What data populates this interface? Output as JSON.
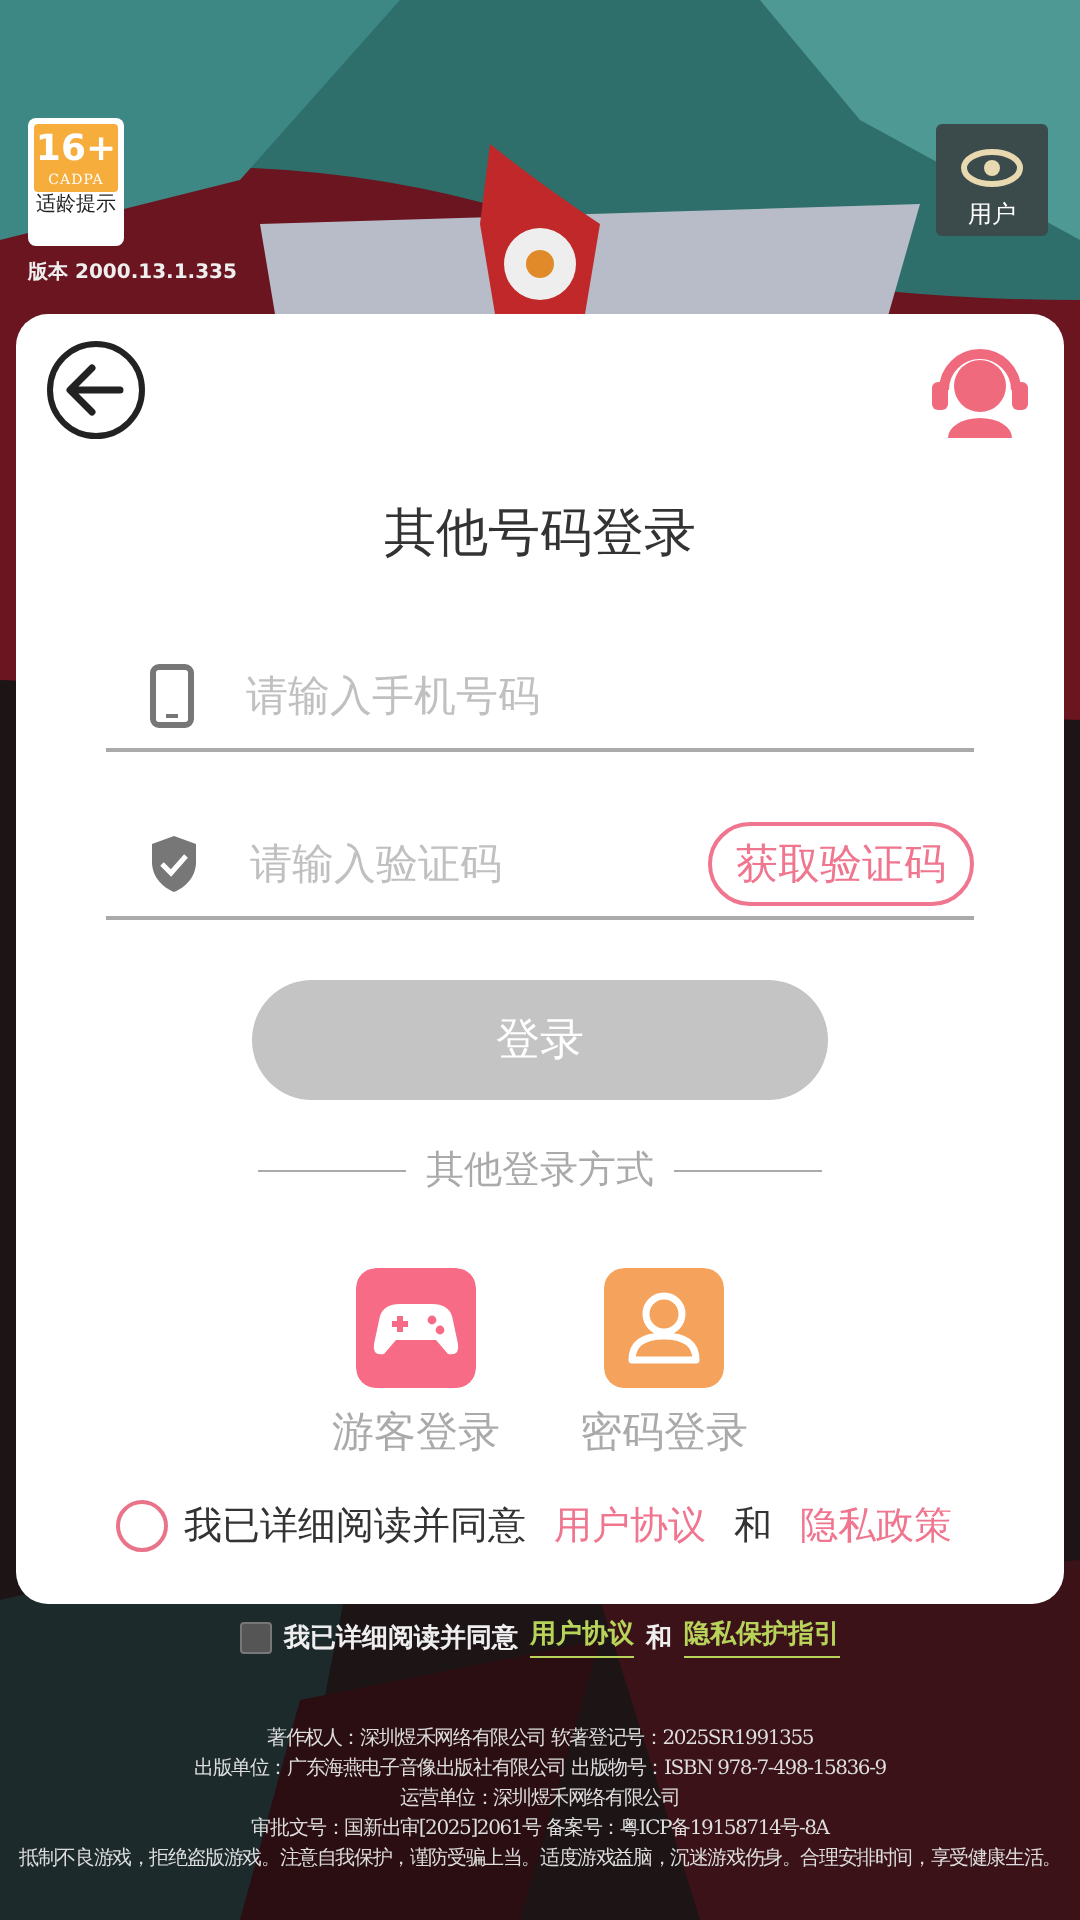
{
  "header": {
    "age_rating": {
      "age": "16+",
      "org": "CADPA",
      "caption": "适龄提示"
    },
    "version": "版本 2000.13.1.335",
    "user_button": "用户"
  },
  "login_card": {
    "title": "其他号码登录",
    "phone_field": {
      "placeholder": "请输入手机号码"
    },
    "code_field": {
      "placeholder": "请输入验证码"
    },
    "get_code_button": "获取验证码",
    "login_button": {
      "label": "登录",
      "disabled": true
    },
    "divider": "其他登录方式",
    "methods": [
      {
        "label": "游客登录",
        "kind": "guest",
        "color": "#f76b86"
      },
      {
        "label": "密码登录",
        "kind": "password",
        "color": "#f5a35c"
      }
    ],
    "agreement": {
      "checked": false,
      "text": "我已详细阅读并同意",
      "link1": "用户协议",
      "and": "和",
      "link2": "隐私政策"
    }
  },
  "outer_agreement": {
    "checked": false,
    "text": "我已详细阅读并同意",
    "link1": "用户协议",
    "and": "和",
    "link2": "隐私保护指引"
  },
  "footer": [
    "著作权人：深圳煜禾网络有限公司 软著登记号：2025SR1991355",
    "出版单位：广东海燕电子音像出版社有限公司  出版物号：ISBN 978-7-498-15836-9",
    "运营单位：深圳煜禾网络有限公司",
    "审批文号：国新出审[2025]2061号 备案号：粤ICP备19158714号-8A",
    "抵制不良游戏，拒绝盗版游戏。注意自我保护，谨防受骗上当。适度游戏益脑，沉迷游戏伤身。合理安排时间，享受健康生活。"
  ]
}
